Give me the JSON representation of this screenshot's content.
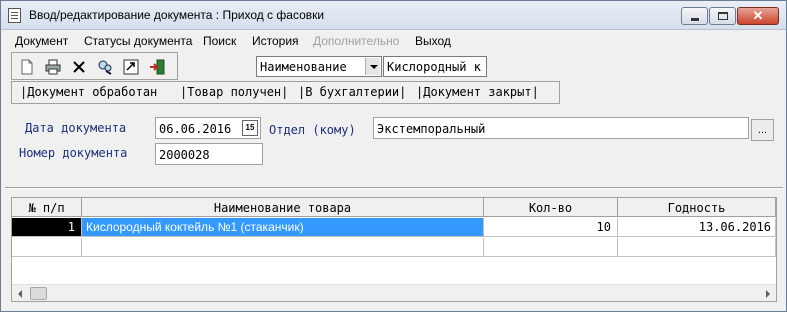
{
  "window": {
    "title": "Ввод/редактирование документа : Приход с фасовки",
    "close_glyph": "✕"
  },
  "menu": {
    "items": [
      "Документ",
      "Статусы документа",
      "Поиск",
      "История",
      "Дополнительно",
      "Выход"
    ]
  },
  "toolbar": {
    "icons": [
      "new-document-icon",
      "print-icon",
      "delete-icon",
      "find-icon",
      "export-icon",
      "exit-door-icon"
    ],
    "search_by": "Наименование",
    "search_value": "Кислородный к"
  },
  "statuses": [
    "|Документ обработан",
    "|Товар получен|",
    "|В бухгалтерии|",
    "|Документ закрыт|"
  ],
  "form": {
    "date_label": "Дата документа",
    "date_value": "06.06.2016",
    "calendar_glyph": "15",
    "dept_label": "Отдел (кому)",
    "dept_value": "Экстемпоральный",
    "number_label": "Номер документа",
    "number_value": "2000028",
    "browse_label": "..."
  },
  "grid": {
    "columns": [
      "№ п/п",
      "Наименование  товара",
      "Кол-во",
      "Годность"
    ],
    "rows": [
      {
        "num": "1",
        "name": "Кислородный коктейль №1 (стаканчик)",
        "qty": "10",
        "expiry": "13.06.2016"
      }
    ]
  }
}
